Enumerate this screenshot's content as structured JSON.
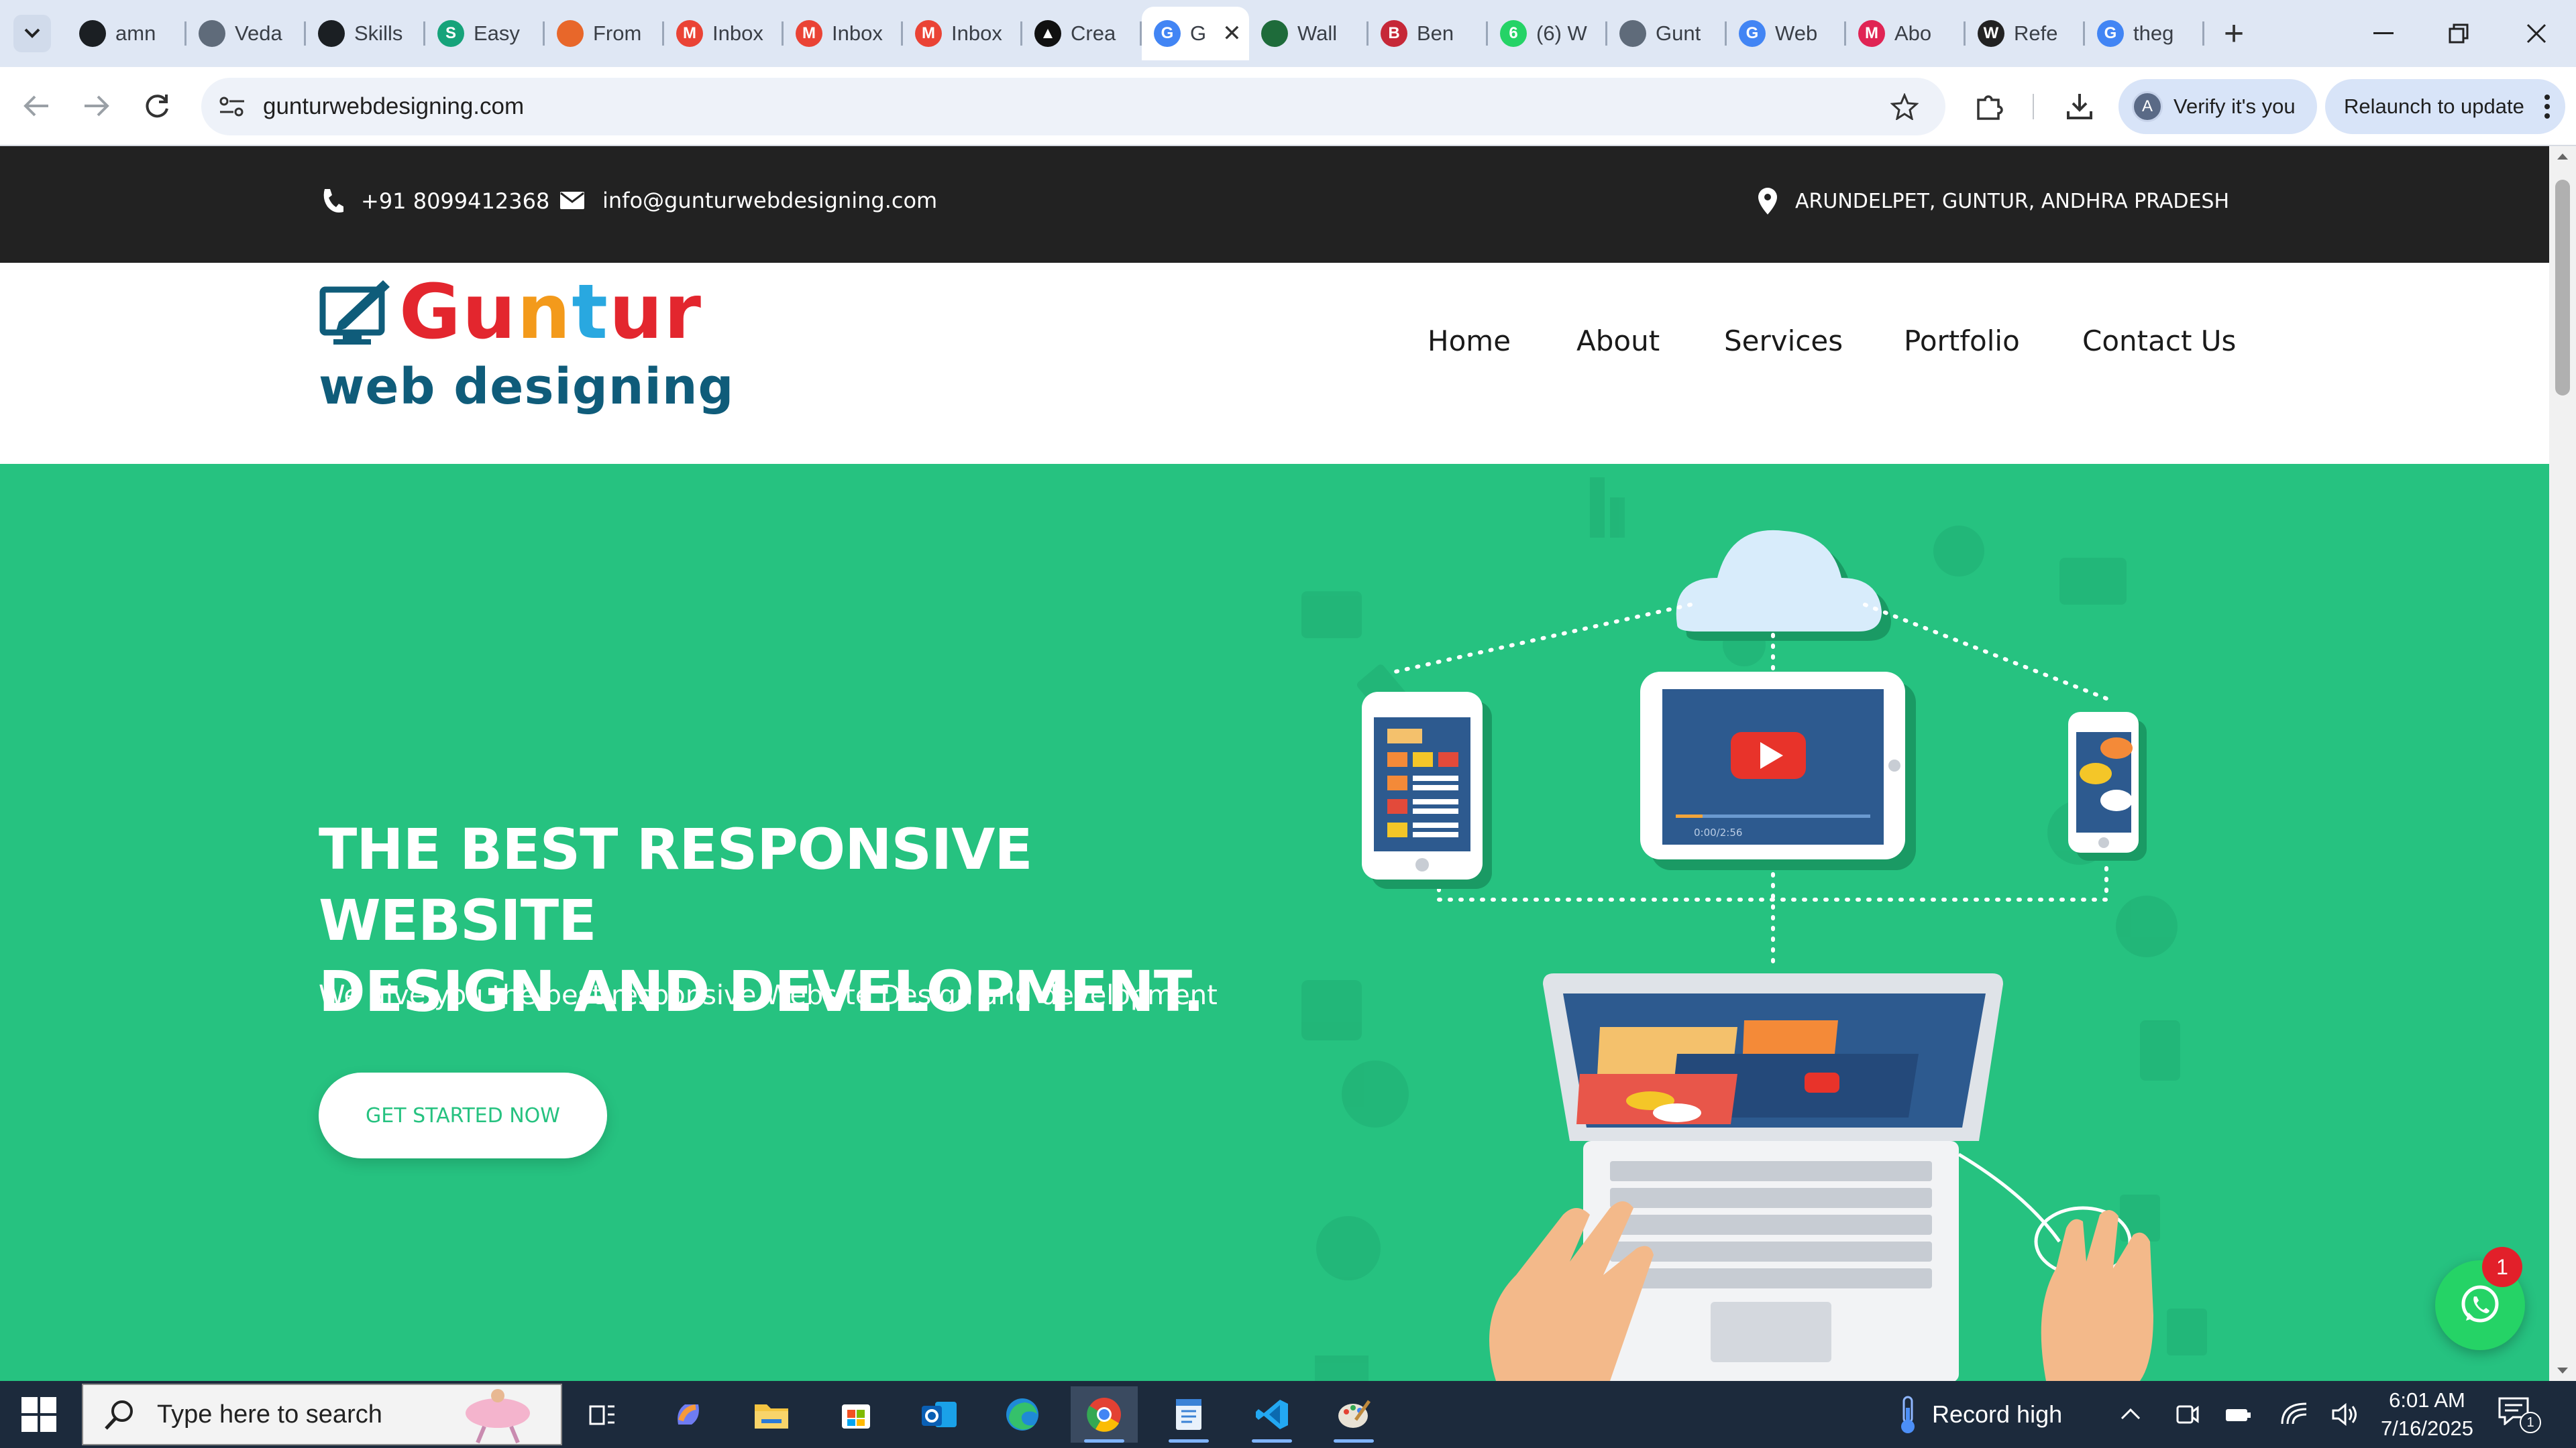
{
  "browser": {
    "tabs": [
      {
        "title": "amn",
        "icon": "github-icon",
        "color": "#1b1f23"
      },
      {
        "title": "Veda",
        "icon": "globe-icon",
        "color": "#5f6b7a"
      },
      {
        "title": "Skills",
        "icon": "openai-icon",
        "color": "#1b1f23"
      },
      {
        "title": "Easy",
        "icon": "s-brand-icon",
        "color": "#16a37a"
      },
      {
        "title": "From",
        "icon": "image-icon",
        "color": "#e8672a"
      },
      {
        "title": "Inbox",
        "icon": "gmail-icon",
        "color": "#ea4335"
      },
      {
        "title": "Inbox",
        "icon": "gmail-icon",
        "color": "#ea4335"
      },
      {
        "title": "Inbox",
        "icon": "gmail-icon",
        "color": "#ea4335"
      },
      {
        "title": "Crea",
        "icon": "triangle-logo-icon",
        "color": "#111111"
      },
      {
        "title": "G",
        "icon": "google-icon",
        "color": "#4285f4",
        "active": true
      },
      {
        "title": "Wall",
        "icon": "feather-icon",
        "color": "#1e6b3a"
      },
      {
        "title": "Ben",
        "icon": "b-brand-icon",
        "color": "#c62838"
      },
      {
        "title": "(6) W",
        "icon": "whatsapp-icon",
        "color": "#25d366"
      },
      {
        "title": "Gunt",
        "icon": "globe-icon",
        "color": "#5f6b7a"
      },
      {
        "title": "Web",
        "icon": "google-icon",
        "color": "#4285f4"
      },
      {
        "title": "Abo",
        "icon": "m-brand-icon",
        "color": "#e02454"
      },
      {
        "title": "Refe",
        "icon": "w-brand-icon",
        "color": "#222222"
      },
      {
        "title": "theg",
        "icon": "google-icon",
        "color": "#4285f4"
      }
    ],
    "url": "gunturwebdesigning.com",
    "verify_label": "Verify it's you",
    "verify_avatar": "A",
    "relaunch_label": "Relaunch to update"
  },
  "site": {
    "topbar": {
      "phone": "+91 8099412368",
      "email": "info@gunturwebdesigning.com",
      "location": "ARUNDELPET, GUNTUR, ANDHRA PRADESH"
    },
    "logo": {
      "title": "Guntur",
      "subtitle": "web designing"
    },
    "nav": [
      "Home",
      "About",
      "Services",
      "Portfolio",
      "Contact Us"
    ],
    "hero": {
      "title_line1": "THE BEST RESPONSIVE WEBSITE",
      "title_line2": "DESIGN AND DEVELOPMENT.",
      "subtitle": "We give you the best responsive Website Design and development",
      "cta": "GET STARTED NOW",
      "video_time": "0:00/2:56"
    },
    "whatsapp_badge": "1",
    "colors": {
      "hero_bg": "#26c280",
      "topbar_bg": "#222222",
      "brand_blue": "#0f5c7a",
      "brand_red": "#e3262e"
    }
  },
  "taskbar": {
    "search_placeholder": "Type here to search",
    "weather": "Record high",
    "time": "6:01 AM",
    "date": "7/16/2025",
    "notifications": "1"
  }
}
